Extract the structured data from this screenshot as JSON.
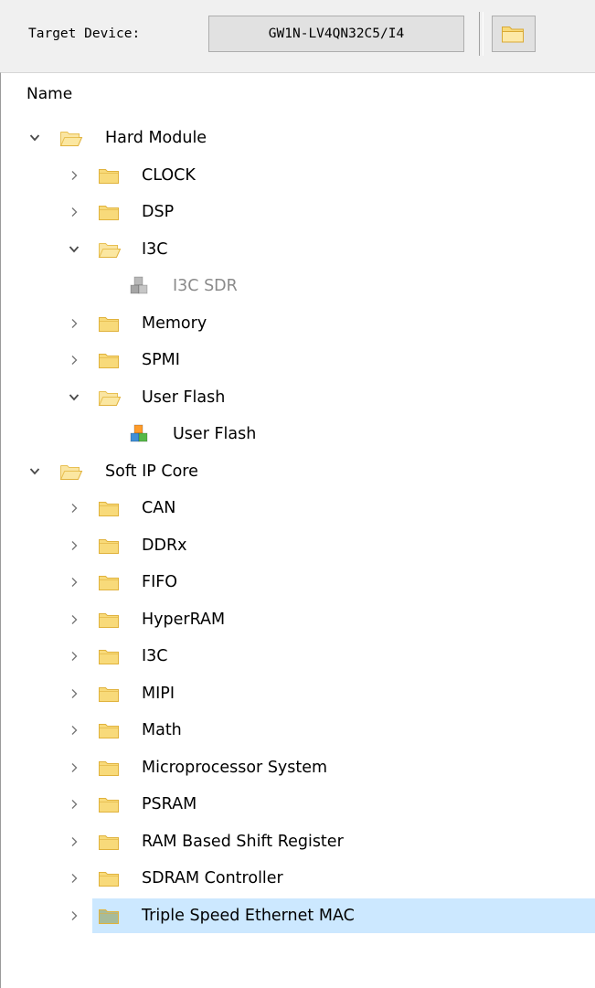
{
  "toolbar": {
    "target_label": "Target Device:",
    "device_value": "GW1N-LV4QN32C5/I4",
    "open_icon": "folder-open-icon"
  },
  "tree": {
    "header": "Name",
    "items": [
      {
        "label": "Hard Module",
        "depth": 0,
        "kind": "folder",
        "expanded": true
      },
      {
        "label": "CLOCK",
        "depth": 1,
        "kind": "folder",
        "expanded": false
      },
      {
        "label": "DSP",
        "depth": 1,
        "kind": "folder",
        "expanded": false
      },
      {
        "label": "I3C",
        "depth": 1,
        "kind": "folder",
        "expanded": true
      },
      {
        "label": "I3C SDR",
        "depth": 2,
        "kind": "ip-disabled"
      },
      {
        "label": "Memory",
        "depth": 1,
        "kind": "folder",
        "expanded": false
      },
      {
        "label": "SPMI",
        "depth": 1,
        "kind": "folder",
        "expanded": false
      },
      {
        "label": "User Flash",
        "depth": 1,
        "kind": "folder",
        "expanded": true
      },
      {
        "label": "User Flash",
        "depth": 2,
        "kind": "ip"
      },
      {
        "label": "Soft IP Core",
        "depth": 0,
        "kind": "folder",
        "expanded": true
      },
      {
        "label": "CAN",
        "depth": 1,
        "kind": "folder",
        "expanded": false
      },
      {
        "label": "DDRx",
        "depth": 1,
        "kind": "folder",
        "expanded": false
      },
      {
        "label": "FIFO",
        "depth": 1,
        "kind": "folder",
        "expanded": false
      },
      {
        "label": "HyperRAM",
        "depth": 1,
        "kind": "folder",
        "expanded": false
      },
      {
        "label": "I3C",
        "depth": 1,
        "kind": "folder",
        "expanded": false
      },
      {
        "label": "MIPI",
        "depth": 1,
        "kind": "folder",
        "expanded": false
      },
      {
        "label": "Math",
        "depth": 1,
        "kind": "folder",
        "expanded": false
      },
      {
        "label": "Microprocessor System",
        "depth": 1,
        "kind": "folder",
        "expanded": false
      },
      {
        "label": "PSRAM",
        "depth": 1,
        "kind": "folder",
        "expanded": false
      },
      {
        "label": "RAM Based Shift Register",
        "depth": 1,
        "kind": "folder",
        "expanded": false
      },
      {
        "label": "SDRAM Controller",
        "depth": 1,
        "kind": "folder",
        "expanded": false
      },
      {
        "label": "Triple Speed Ethernet MAC",
        "depth": 1,
        "kind": "folder",
        "expanded": false,
        "selected": true
      }
    ]
  },
  "colors": {
    "folder_fill": "#f8da7a",
    "folder_edge": "#e0b23c",
    "folder_open_fill": "#fbe7a1",
    "folder_selected_fill": "#a7bb9a",
    "selection_bg": "#cce8ff",
    "disabled_text": "#8a8a8a"
  }
}
